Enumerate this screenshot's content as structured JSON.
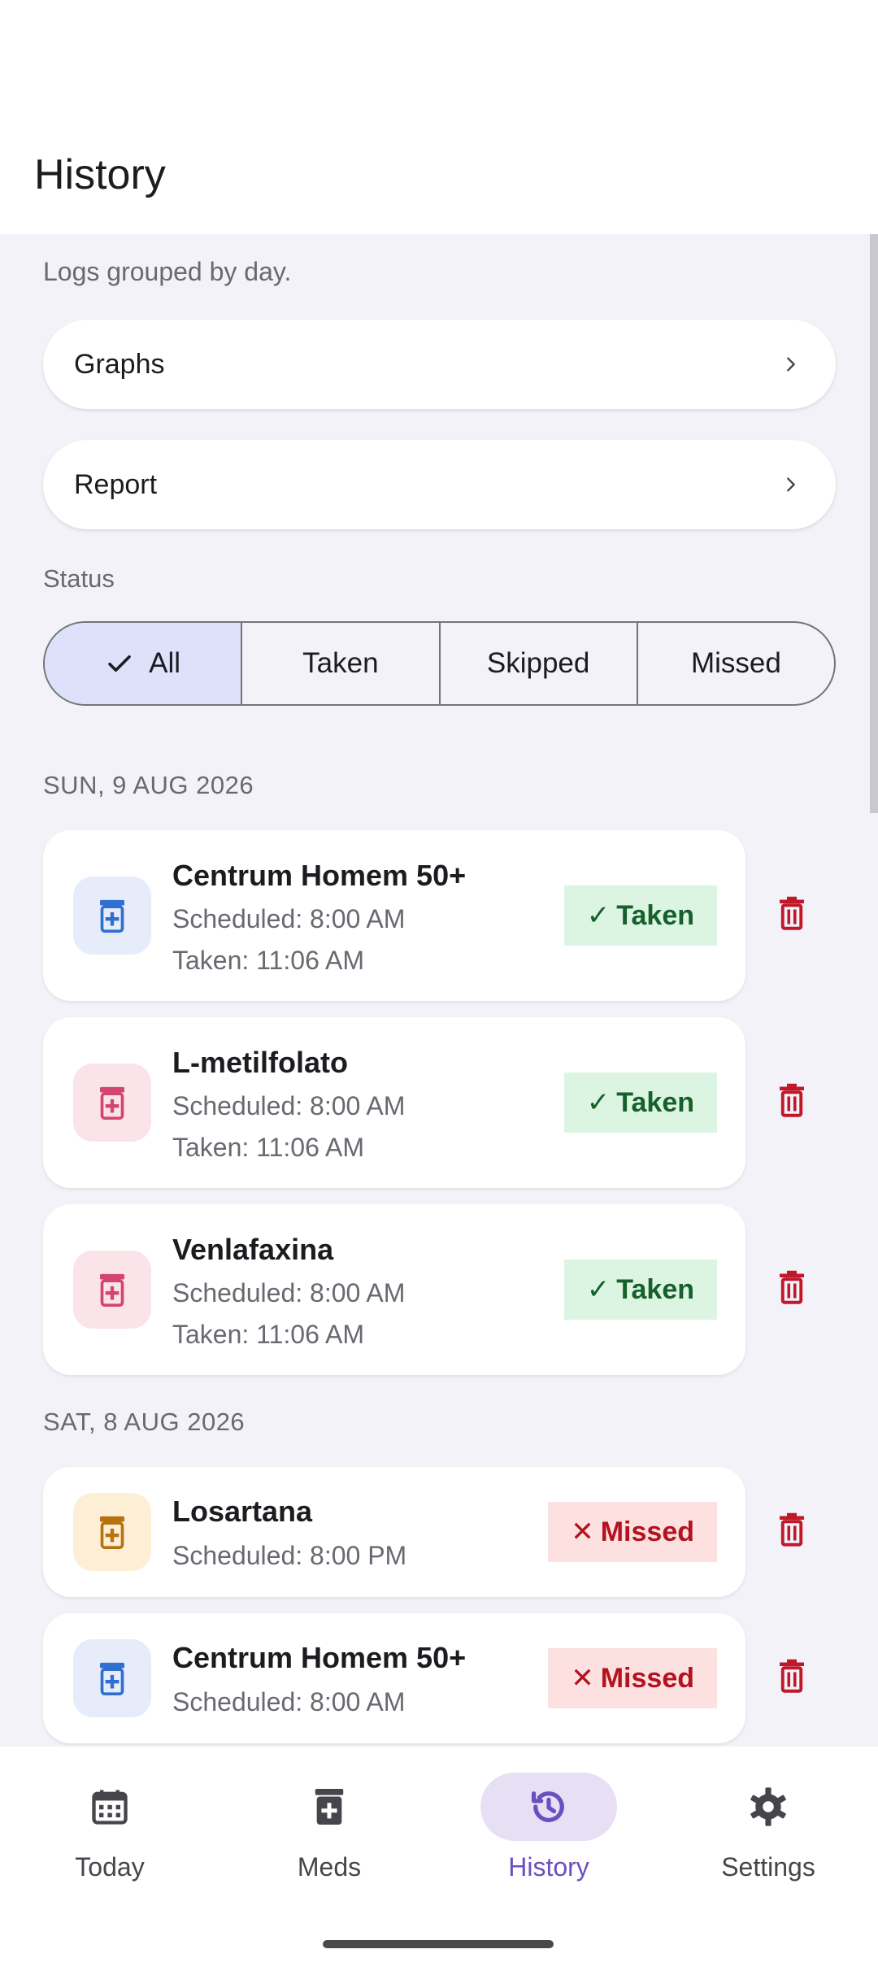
{
  "header": {
    "title": "History"
  },
  "subtitle": "Logs grouped by day.",
  "nav_cards": [
    {
      "label": "Graphs"
    },
    {
      "label": "Report"
    }
  ],
  "status_filter": {
    "label": "Status",
    "options": [
      "All",
      "Taken",
      "Skipped",
      "Missed"
    ],
    "selected": "All"
  },
  "days": [
    {
      "date": "SUN, 9 AUG 2026",
      "logs": [
        {
          "name": "Centrum Homem 50+",
          "scheduled": "Scheduled: 8:00 AM",
          "taken": "Taken: 11:06 AM",
          "status": "Taken",
          "status_mark": "✓",
          "icon_color": "blue"
        },
        {
          "name": "L-metilfolato",
          "scheduled": "Scheduled: 8:00 AM",
          "taken": "Taken: 11:06 AM",
          "status": "Taken",
          "status_mark": "✓",
          "icon_color": "pink"
        },
        {
          "name": "Venlafaxina",
          "scheduled": "Scheduled: 8:00 AM",
          "taken": "Taken: 11:06 AM",
          "status": "Taken",
          "status_mark": "✓",
          "icon_color": "pink"
        }
      ]
    },
    {
      "date": "SAT, 8 AUG 2026",
      "logs": [
        {
          "name": "Losartana",
          "scheduled": "Scheduled: 8:00 PM",
          "status": "Missed",
          "status_mark": "✕",
          "icon_color": "amber"
        },
        {
          "name": "Centrum Homem 50+",
          "scheduled": "Scheduled: 8:00 AM",
          "status": "Missed",
          "status_mark": "✕",
          "icon_color": "blue"
        }
      ]
    }
  ],
  "bottom_nav": [
    {
      "label": "Today",
      "icon": "calendar-icon"
    },
    {
      "label": "Meds",
      "icon": "pill-bottle-icon"
    },
    {
      "label": "History",
      "icon": "history-icon",
      "active": true
    },
    {
      "label": "Settings",
      "icon": "gear-icon"
    }
  ],
  "colors": {
    "accent": "#6b4fc0",
    "taken_bg": "#dcf5e2",
    "taken_text": "#16602c",
    "missed_bg": "#fde0e0",
    "missed_text": "#b3121f",
    "delete": "#c0182a",
    "icon_blue": "#2f6fd0",
    "icon_pink": "#d3446f",
    "icon_amber": "#b6720f"
  }
}
